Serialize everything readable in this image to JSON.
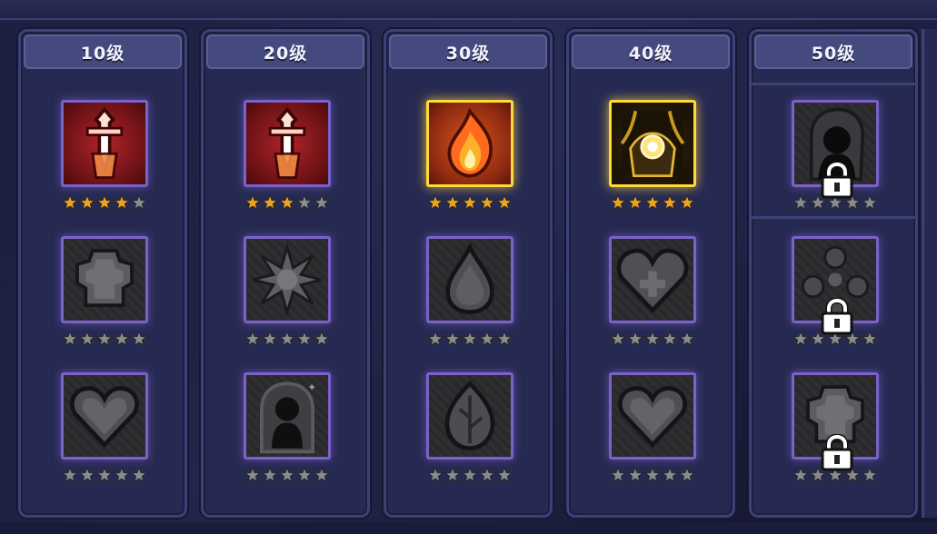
{
  "colors": {
    "unlocked_star": "#f0a21e",
    "locked_star": "#8a8a93",
    "frame_border": "#7a62c9",
    "frame_border_active": "#ffd93a"
  },
  "columns": [
    {
      "label": "10级",
      "skills": [
        {
          "icon": "crystal-sword-icon",
          "state": "unlocked",
          "stars_filled": 4,
          "stars_total": 5
        },
        {
          "icon": "gear-icon",
          "state": "inactive",
          "stars_filled": 0,
          "stars_total": 5
        },
        {
          "icon": "heart-icon",
          "state": "inactive",
          "stars_filled": 0,
          "stars_total": 5
        }
      ]
    },
    {
      "label": "20级",
      "skills": [
        {
          "icon": "crystal-sword-icon",
          "state": "unlocked",
          "stars_filled": 3,
          "stars_total": 5
        },
        {
          "icon": "burst-icon",
          "state": "inactive",
          "stars_filled": 0,
          "stars_total": 5
        },
        {
          "icon": "shadow-figure-icon",
          "state": "inactive",
          "stars_filled": 0,
          "stars_total": 5
        }
      ]
    },
    {
      "label": "30级",
      "skills": [
        {
          "icon": "flame-icon",
          "state": "active",
          "stars_filled": 5,
          "stars_total": 5
        },
        {
          "icon": "droplet-icon",
          "state": "inactive",
          "stars_filled": 0,
          "stars_total": 5
        },
        {
          "icon": "leaf-icon",
          "state": "inactive",
          "stars_filled": 0,
          "stars_total": 5
        }
      ]
    },
    {
      "label": "40级",
      "skills": [
        {
          "icon": "dark-orb-icon",
          "state": "active",
          "stars_filled": 5,
          "stars_total": 5
        },
        {
          "icon": "heart-plus-icon",
          "state": "inactive",
          "stars_filled": 0,
          "stars_total": 5
        },
        {
          "icon": "heart-icon",
          "state": "inactive",
          "stars_filled": 0,
          "stars_total": 5
        }
      ]
    },
    {
      "label": "50级",
      "skills": [
        {
          "icon": "hooded-figure-icon",
          "state": "locked",
          "stars_filled": 0,
          "stars_total": 5
        },
        {
          "icon": "orbs-icon",
          "state": "locked",
          "stars_filled": 0,
          "stars_total": 5
        },
        {
          "icon": "gear-icon",
          "state": "locked",
          "stars_filled": 0,
          "stars_total": 5
        }
      ]
    }
  ]
}
